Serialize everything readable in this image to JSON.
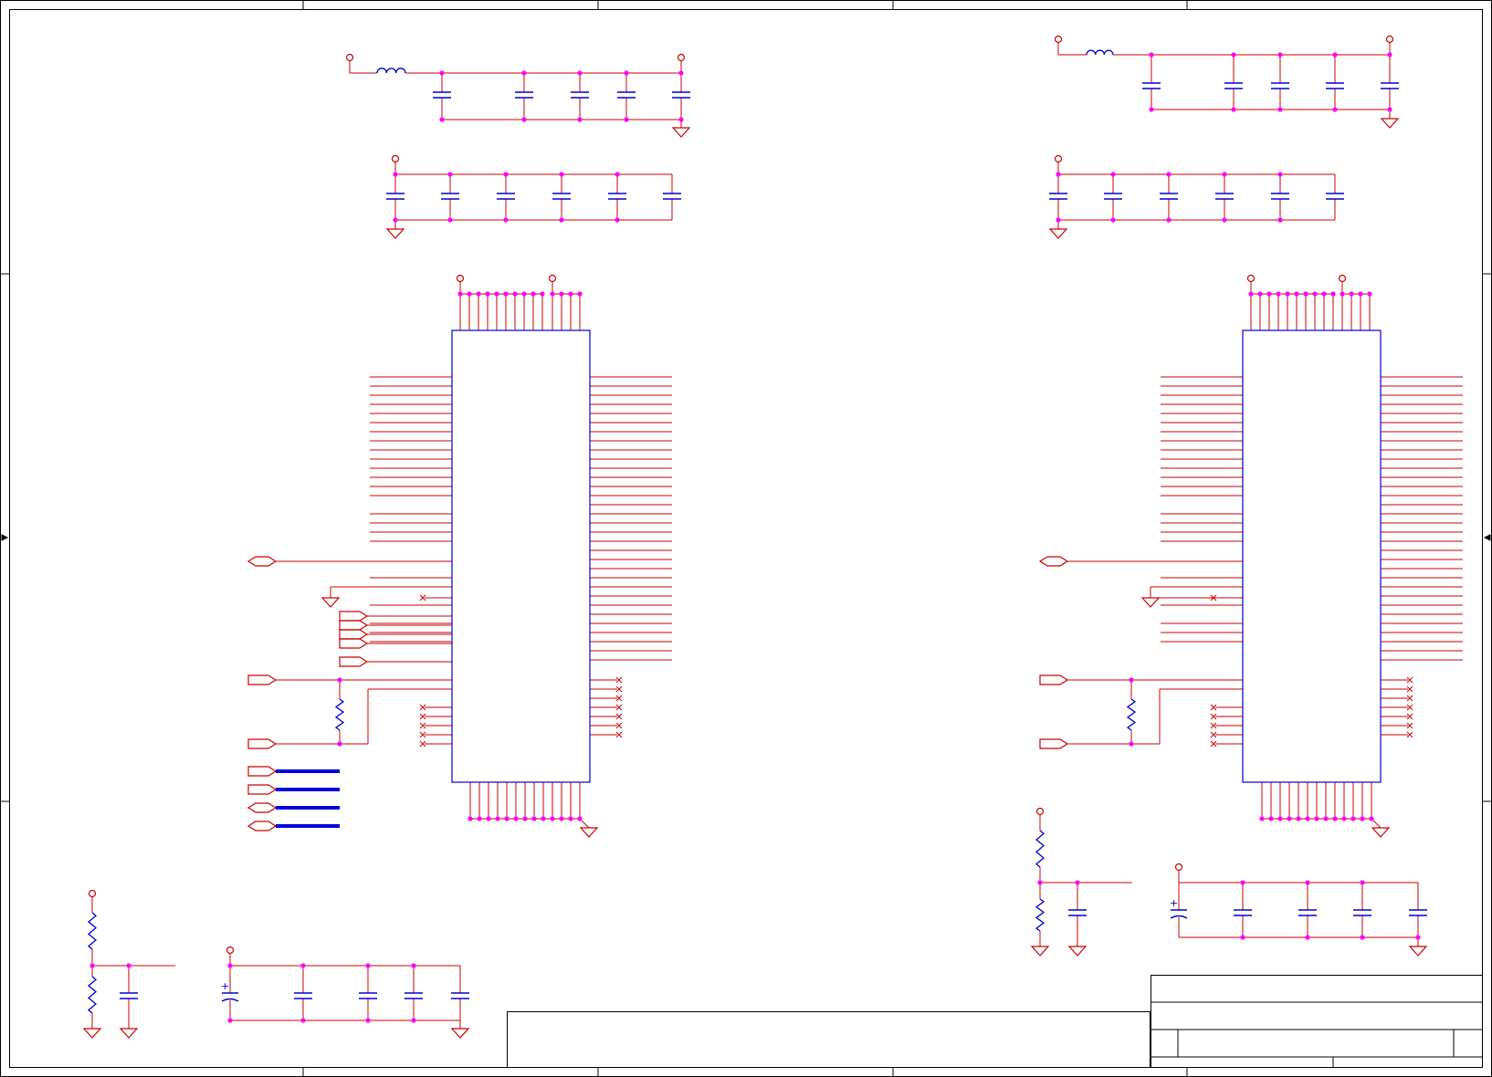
{
  "sheet": {
    "title": "",
    "border_color": "#000000",
    "wire_color": "#cc0000",
    "component_color": "#0000cc",
    "bus_color": "#0000dd",
    "junction_color": "#ff00ff",
    "port_color": "#cc0000"
  },
  "title_block": {
    "title": "",
    "size": "",
    "document_number": "",
    "revision": "",
    "date": "",
    "sheet": ""
  },
  "icons": {
    "power": "power-port-circle-icon",
    "ground": "ground-triangle-icon",
    "no_connect": "no-connect-x-icon",
    "port": "off-sheet-port-icon"
  }
}
